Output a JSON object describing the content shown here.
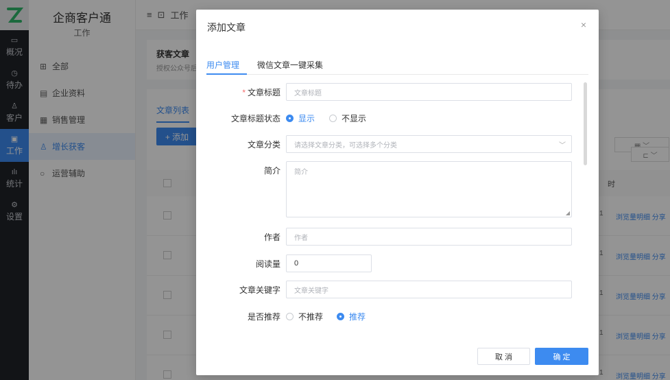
{
  "rail": {
    "items": [
      {
        "icon": "chart-icon",
        "label": "概况"
      },
      {
        "icon": "clock-icon",
        "label": "待办"
      },
      {
        "icon": "customer-icon",
        "label": "客户"
      },
      {
        "icon": "briefcase-icon",
        "label": "工作"
      },
      {
        "icon": "stats-icon",
        "label": "统计"
      },
      {
        "icon": "settings-icon",
        "label": "设置"
      }
    ]
  },
  "sidebar": {
    "title": "企商客户通",
    "subtitle": "工作",
    "items": [
      {
        "icon": "grid-icon",
        "label": "全部"
      },
      {
        "icon": "document-icon",
        "label": "企业资料"
      },
      {
        "icon": "calendar-icon",
        "label": "销售管理"
      },
      {
        "icon": "user-growth-icon",
        "label": "增长获客"
      },
      {
        "icon": "loop-icon",
        "label": "运营辅助"
      }
    ]
  },
  "background": {
    "breadcrumb": "工作",
    "card_title": "获客文章",
    "card_desc": "授权公众号后",
    "list_tab": "文章列表",
    "add_button": "+ 添加",
    "col_header": "时",
    "row_count": "1",
    "row_links": "浏览量明细  分享",
    "rows": 5
  },
  "modal": {
    "title": "添加文章",
    "close": "×",
    "tabs": [
      "用户管理",
      "微信文章一键采集"
    ],
    "fields": {
      "title_label": "文章标题",
      "title_placeholder": "文章标题",
      "status_label": "文章标题状态",
      "status_options": [
        "显示",
        "不显示"
      ],
      "category_label": "文章分类",
      "category_placeholder": "请选择文章分类，可选择多个分类",
      "intro_label": "简介",
      "intro_placeholder": "简介",
      "author_label": "作者",
      "author_placeholder": "作者",
      "reads_label": "阅读量",
      "reads_value": "0",
      "keywords_label": "文章关键字",
      "keywords_placeholder": "文章关键字",
      "recommend_label": "是否推荐",
      "recommend_options": [
        "不推荐",
        "推荐"
      ]
    },
    "cancel": "取 消",
    "confirm": "确 定"
  },
  "colors": {
    "primary": "#3d8bf0",
    "rail_bg": "#1f2329",
    "required": "#f56c6c"
  }
}
